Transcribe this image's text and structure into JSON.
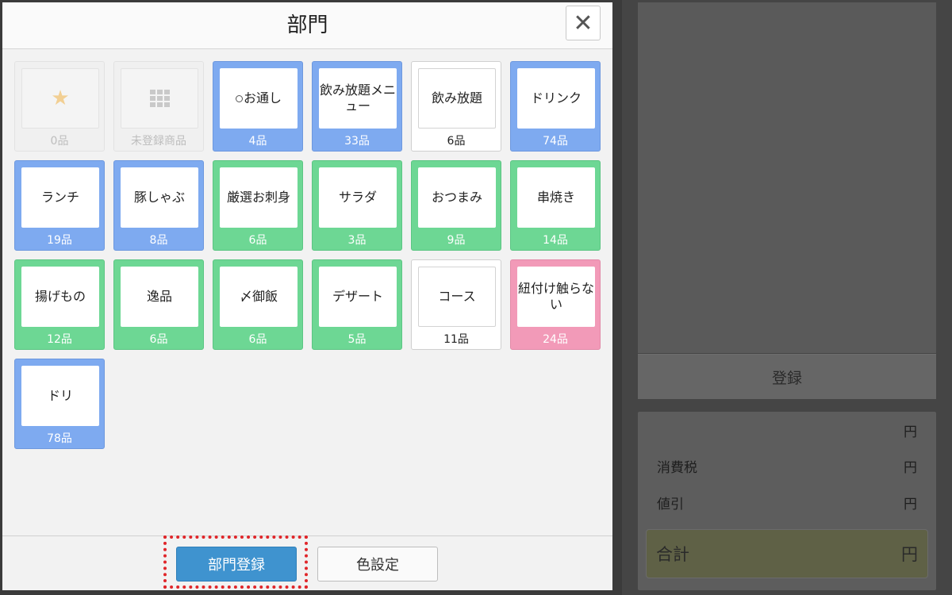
{
  "modal": {
    "title": "部門",
    "close_label": "✕"
  },
  "tiles": [
    {
      "label": "",
      "icon": "star-icon",
      "count": "0品",
      "style": "disabled"
    },
    {
      "label": "",
      "icon": "grid-icon",
      "count": "未登録商品",
      "style": "disabled"
    },
    {
      "label": "お通し",
      "prefix_icon": "dot-icon",
      "count": "4品",
      "style": "blue"
    },
    {
      "label": "飲み放題メニュー",
      "count": "33品",
      "style": "blue"
    },
    {
      "label": "飲み放題",
      "count": "6品",
      "style": "white"
    },
    {
      "label": "ドリンク",
      "count": "74品",
      "style": "blue"
    },
    {
      "label": "ランチ",
      "count": "19品",
      "style": "blue"
    },
    {
      "label": "豚しゃぶ",
      "count": "8品",
      "style": "blue"
    },
    {
      "label": "厳選お刺身",
      "count": "6品",
      "style": "green"
    },
    {
      "label": "サラダ",
      "count": "3品",
      "style": "green"
    },
    {
      "label": "おつまみ",
      "count": "9品",
      "style": "green"
    },
    {
      "label": "串焼き",
      "count": "14品",
      "style": "green"
    },
    {
      "label": "揚げもの",
      "count": "12品",
      "style": "green"
    },
    {
      "label": "逸品",
      "count": "6品",
      "style": "green"
    },
    {
      "label": "〆御飯",
      "count": "6品",
      "style": "green"
    },
    {
      "label": "デザート",
      "count": "5品",
      "style": "green"
    },
    {
      "label": "コース",
      "count": "11品",
      "style": "white"
    },
    {
      "label": "紐付け触らない",
      "count": "24品",
      "style": "pink"
    },
    {
      "label": "ドリ",
      "count": "78品",
      "style": "blue"
    }
  ],
  "footer": {
    "register_label": "部門登録",
    "color_label": "色設定"
  },
  "right_panel": {
    "register_label": "登録",
    "subtotal_unit": "円",
    "tax_label": "消費税",
    "tax_unit": "円",
    "discount_label": "値引",
    "discount_unit": "円",
    "total_label": "合計",
    "total_unit": "円"
  },
  "colors": {
    "blue": "#7eaaf0",
    "green": "#6dd794",
    "pink": "#f29ab8",
    "primary_button": "#3f93cf",
    "highlight": "#e0262a"
  }
}
